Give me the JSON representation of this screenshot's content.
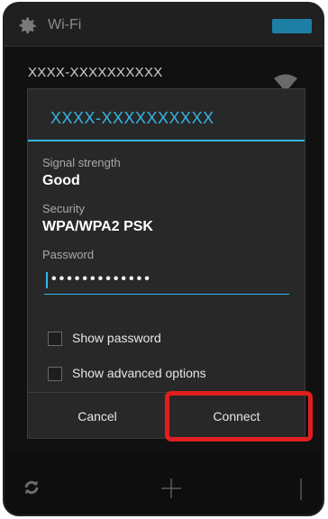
{
  "background": {
    "title": "Wi-Fi",
    "network_name": "XXXX-XXXXXXXXXX",
    "icons": [
      "gear-icon",
      "wifi-signal-icon",
      "scan-icon",
      "add-icon",
      "overflow-menu-icon"
    ]
  },
  "dialog": {
    "title": "XXXX-XXXXXXXXXX",
    "signal_label": "Signal strength",
    "signal_value": "Good",
    "security_label": "Security",
    "security_value": "WPA/WPA2 PSK",
    "password_label": "Password",
    "password_value": "•••••••••••••",
    "show_password_label": "Show password",
    "show_advanced_label": "Show advanced options",
    "cancel_label": "Cancel",
    "connect_label": "Connect"
  },
  "colors": {
    "accent": "#33b5e5",
    "highlight": "#e01e1e",
    "dialog_bg": "#282828"
  }
}
